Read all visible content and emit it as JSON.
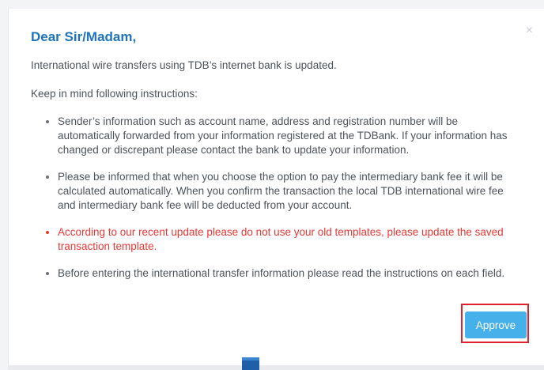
{
  "dialog": {
    "close_glyph": "×",
    "title": "Dear Sir/Madam,",
    "intro": "International wire transfers using TDB’s internet bank is updated.",
    "instructions_heading": "Keep in mind following instructions:",
    "items": [
      {
        "text": "Sender’s information such as account name, address and registration number will be automatically forwarded from your information registered at the TDBank. If your information has changed or discrepant please contact the bank to update your information.",
        "color": "#4d535a"
      },
      {
        "text": "Please be informed that when you choose the option to pay the intermediary bank fee it will be calculated automatically. When you confirm the transaction the local TDB international wire fee and intermediary bank fee will be deducted from your account.",
        "color": "#4d535a"
      },
      {
        "text": "According to our recent update please do not use your old templates, please update the saved transaction template.",
        "color": "#e53935"
      },
      {
        "text": "Before entering the international transfer information please read the instructions on each field.",
        "color": "#4d535a"
      }
    ],
    "approve_label": "Approve"
  },
  "colors": {
    "title": "#1f74b8",
    "body_text": "#4d535a",
    "warning": "#e53935",
    "button": "#45b0ea",
    "highlight_border": "#e0202a"
  },
  "icons": {
    "close": "close-icon",
    "bullet": "bullet-icon"
  }
}
